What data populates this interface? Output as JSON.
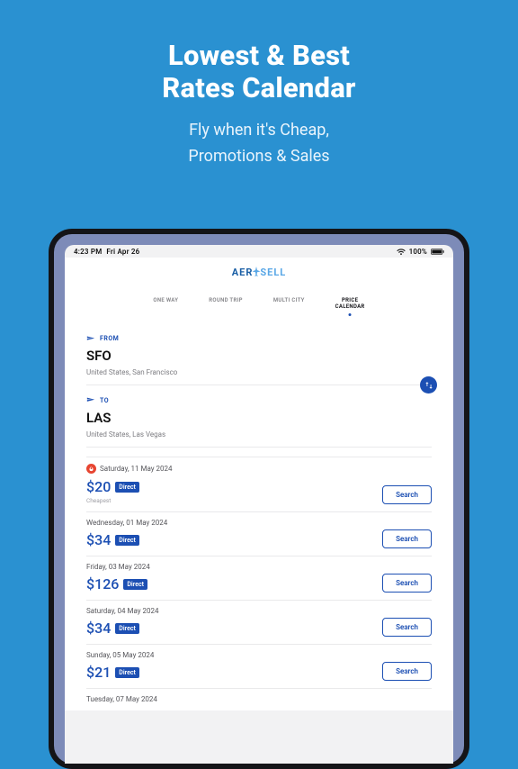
{
  "promo": {
    "headline_l1": "Lowest & Best",
    "headline_l2": "Rates Calendar",
    "subhead_l1": "Fly when it's Cheap,",
    "subhead_l2": "Promotions & Sales"
  },
  "status": {
    "time": "4:23 PM",
    "date": "Fri Apr 26",
    "battery": "100%"
  },
  "logo": {
    "part1": "AER",
    "part2": "SELL"
  },
  "tabs": {
    "one_way": "ONE WAY",
    "round_trip": "ROUND TRIP",
    "multi_city": "MULTI CITY",
    "price_calendar_l1": "PRICE",
    "price_calendar_l2": "CALENDAR"
  },
  "from": {
    "label": "FROM",
    "code": "SFO",
    "location": "United States, San Francisco"
  },
  "to": {
    "label": "TO",
    "code": "LAS",
    "location": "United States, Las Vegas"
  },
  "labels": {
    "direct": "Direct",
    "search": "Search",
    "cheapest": "Cheapest"
  },
  "results": [
    {
      "date": "Saturday, 11 May 2024",
      "price": "$20",
      "hot": true,
      "cheapest": true
    },
    {
      "date": "Wednesday, 01 May 2024",
      "price": "$34",
      "hot": false,
      "cheapest": false
    },
    {
      "date": "Friday, 03 May 2024",
      "price": "$126",
      "hot": false,
      "cheapest": false
    },
    {
      "date": "Saturday, 04 May 2024",
      "price": "$34",
      "hot": false,
      "cheapest": false
    },
    {
      "date": "Sunday, 05 May 2024",
      "price": "$21",
      "hot": false,
      "cheapest": false
    },
    {
      "date": "Tuesday, 07 May 2024",
      "price": "",
      "hot": false,
      "cheapest": false
    }
  ],
  "colors": {
    "brand": "#1c4fb3",
    "bg": "#2a91d1",
    "hot": "#e74531"
  }
}
